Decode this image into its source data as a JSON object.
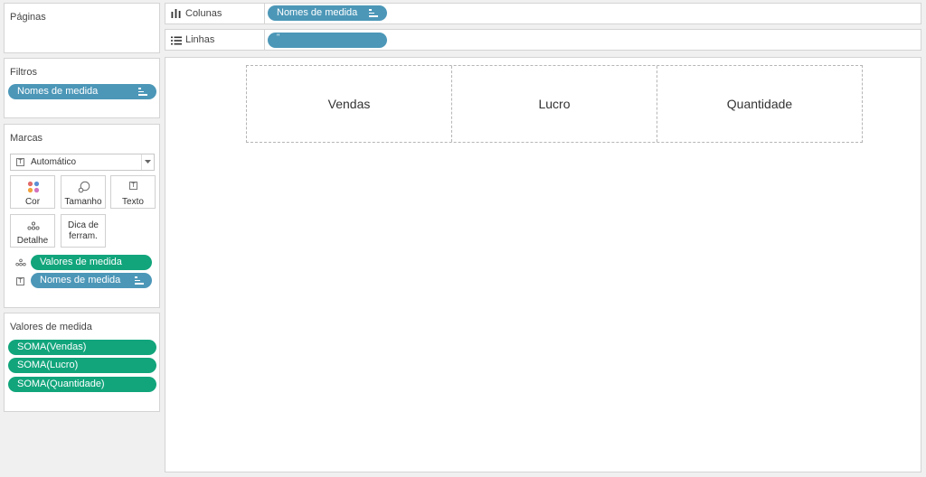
{
  "left_panel": {
    "pages": {
      "title": "Páginas"
    },
    "filters": {
      "title": "Filtros",
      "pills": [
        {
          "label": "Nomes de medida",
          "color": "#4c97b8"
        }
      ]
    },
    "marks": {
      "title": "Marcas",
      "mark_type": {
        "label": "Automático"
      },
      "buttons": {
        "color": "Cor",
        "size": "Tamanho",
        "text": "Texto",
        "detail": "Detalhe",
        "tooltip_line1": "Dica de",
        "tooltip_line2": "ferram."
      },
      "fields": [
        {
          "label": "Valores de medida",
          "icon": "detail-icon",
          "color": "#12a57c"
        },
        {
          "label": "Nomes de medida",
          "icon": "text-icon",
          "color": "#4c97b8"
        }
      ]
    },
    "measure_values": {
      "title": "Valores de medida",
      "items": [
        "SOMA(Vendas)",
        "SOMA(Lucro)",
        "SOMA(Quantidade)"
      ]
    }
  },
  "shelves": {
    "columns": {
      "label": "Colunas",
      "pill": "Nomes de medida",
      "icon": "columns-icon"
    },
    "rows": {
      "label": "Linhas",
      "pill": "\"",
      "icon": "rows-icon"
    }
  },
  "view": {
    "headers": [
      "Vendas",
      "Lucro",
      "Quantidade"
    ]
  },
  "colors": {
    "dimension_pill": "#4c97b8",
    "measure_pill": "#12a57c"
  }
}
